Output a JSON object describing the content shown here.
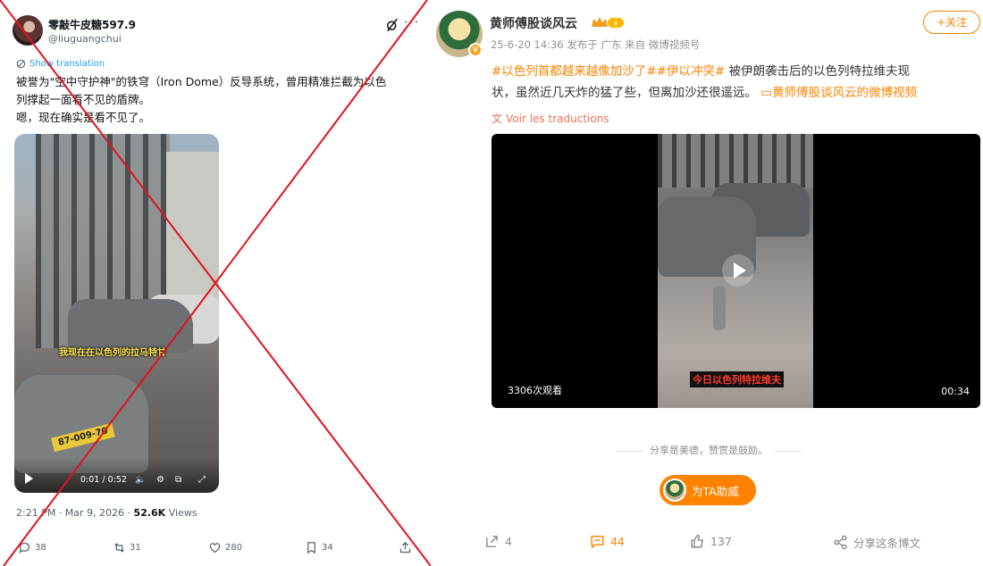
{
  "left": {
    "author": {
      "name": "零敲牛皮糖597.9",
      "handle": "@liuguangchui"
    },
    "translate_label": "Show translation",
    "text_line1": "被誉为\"空中守护神\"的铁穹（Iron Dome）反导系统，曾用精准拦截为以色",
    "text_line2": "列撑起一面看不见的盾牌。",
    "text_line3": "嗯，现在确实是看不见了。",
    "video": {
      "subtitle": "我现在在以色列的拉马特甘",
      "plate": "87-009-70",
      "time": "0:01 / 0:52"
    },
    "meta": {
      "time": "2:21 PM · Mar 9, 2026 · ",
      "views": "52.6K",
      "views_label": " Views"
    },
    "actions": {
      "replies": "38",
      "reposts": "31",
      "likes": "280",
      "bookmarks": "34"
    }
  },
  "right": {
    "author": {
      "name": "黄师傅股谈风云",
      "badge": "Ⅱ"
    },
    "sub": "25-6-20 14:36  发布于 广东  来自 微博视频号",
    "follow_label": "+关注",
    "hashtag1": "#以色列首都越来越像加沙了#",
    "hashtag2": "#伊以冲突#",
    "body1": " 被伊朗袭击后的以色列特拉维夫现",
    "body2": "状，虽然近几天炸的猛了些，但离加沙还很遥远。",
    "video_link": "黄师傅股谈风云的微博视频",
    "translate_label": "Voir les traductions",
    "video": {
      "caption": "今日以色列特拉维夫",
      "views": "3306次观看",
      "duration": "00:34"
    },
    "share_line": "分享是美德，赞赏是鼓励。",
    "reward_label": "为TA助威",
    "actions": {
      "share": "4",
      "comments": "44",
      "likes": "137",
      "share_post": "分享这条博文"
    },
    "colors": {
      "accent": "#ff8200"
    }
  }
}
